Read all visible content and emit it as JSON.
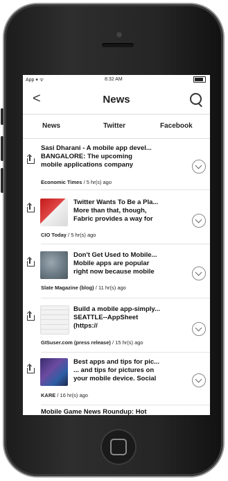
{
  "status": {
    "left": "App ▾ ᯤ",
    "time": "8:32 AM"
  },
  "nav": {
    "back": "<",
    "title": "News"
  },
  "tabs": [
    "News",
    "Twitter",
    "Facebook"
  ],
  "items": [
    {
      "lines": [
        "Sasi Dharani - A mobile app devel...",
        "BANGALORE: The upcoming",
        "mobile applications company"
      ],
      "source": "Economic Times",
      "age": "/ 5 hr(s) ago"
    },
    {
      "lines": [
        "Twitter Wants To Be a Pla...",
        "More than that, though,",
        "Fabric provides a way for"
      ],
      "source": "CIO Today",
      "age": "/ 5 hr(s) ago"
    },
    {
      "lines": [
        "Don't Get Used to Mobile...",
        "Mobile apps are popular",
        "right now because mobile"
      ],
      "source": "Slate Magazine (blog)",
      "age": "/ 11 hr(s) ago"
    },
    {
      "lines": [
        "Build a mobile app-simply...",
        "SEATTLE--AppSheet",
        "(https://"
      ],
      "source": "GISuser.com (press release)",
      "age": "/ 15 hr(s) ago"
    },
    {
      "lines": [
        "Best apps and tips for pic...",
        "... and tips for pictures on",
        "your mobile device. Social"
      ],
      "source": "KARE",
      "age": "/ 16 hr(s) ago"
    },
    {
      "lines": [
        "Mobile Game News Roundup: Hot"
      ],
      "source": "",
      "age": ""
    }
  ]
}
